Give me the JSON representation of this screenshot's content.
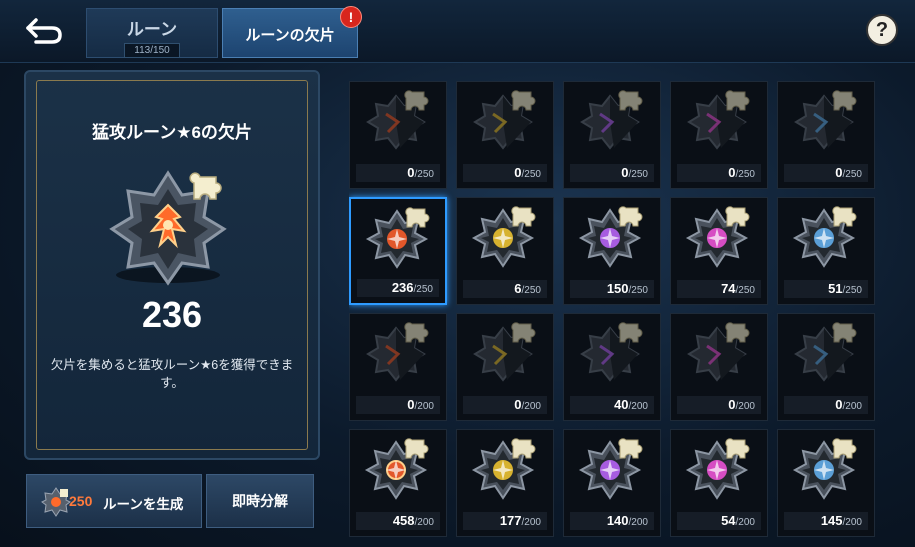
{
  "tabs": {
    "runes": {
      "label": "ルーン",
      "count": "113/150"
    },
    "shards": {
      "label": "ルーンの欠片",
      "alert": "!"
    }
  },
  "help_label": "?",
  "detail": {
    "title": "猛攻ルーン★6の欠片",
    "count": "236",
    "description": "欠片を集めると猛攻ルーン★6を獲得できます。"
  },
  "buttons": {
    "generate": {
      "cost": "250",
      "label": "ルーンを生成"
    },
    "dismantle": "即時分解"
  },
  "shards": [
    {
      "row": 0,
      "col": 0,
      "count": "0",
      "max": "/250",
      "color": "#e2572a",
      "kind": "broken"
    },
    {
      "row": 0,
      "col": 1,
      "count": "0",
      "max": "/250",
      "color": "#d7b22f",
      "kind": "broken"
    },
    {
      "row": 0,
      "col": 2,
      "count": "0",
      "max": "/250",
      "color": "#a75ce0",
      "kind": "broken"
    },
    {
      "row": 0,
      "col": 3,
      "count": "0",
      "max": "/250",
      "color": "#d64dc3",
      "kind": "broken"
    },
    {
      "row": 0,
      "col": 4,
      "count": "0",
      "max": "/250",
      "color": "#5b9fd6",
      "kind": "broken"
    },
    {
      "row": 1,
      "col": 0,
      "count": "236",
      "max": "/250",
      "color": "#e2572a",
      "kind": "full",
      "selected": true
    },
    {
      "row": 1,
      "col": 1,
      "count": "6",
      "max": "/250",
      "color": "#d7b22f",
      "kind": "full"
    },
    {
      "row": 1,
      "col": 2,
      "count": "150",
      "max": "/250",
      "color": "#a75ce0",
      "kind": "full"
    },
    {
      "row": 1,
      "col": 3,
      "count": "74",
      "max": "/250",
      "color": "#d64dc3",
      "kind": "full"
    },
    {
      "row": 1,
      "col": 4,
      "count": "51",
      "max": "/250",
      "color": "#5b9fd6",
      "kind": "full"
    },
    {
      "row": 2,
      "col": 0,
      "count": "0",
      "max": "/200",
      "color": "#e2572a",
      "kind": "broken"
    },
    {
      "row": 2,
      "col": 1,
      "count": "0",
      "max": "/200",
      "color": "#d7b22f",
      "kind": "broken"
    },
    {
      "row": 2,
      "col": 2,
      "count": "40",
      "max": "/200",
      "color": "#a75ce0",
      "kind": "broken"
    },
    {
      "row": 2,
      "col": 3,
      "count": "0",
      "max": "/200",
      "color": "#d64dc3",
      "kind": "broken"
    },
    {
      "row": 2,
      "col": 4,
      "count": "0",
      "max": "/200",
      "color": "#5b9fd6",
      "kind": "broken"
    },
    {
      "row": 3,
      "col": 0,
      "count": "458",
      "max": "/200",
      "color": "#e2572a",
      "kind": "full",
      "bright": true
    },
    {
      "row": 3,
      "col": 1,
      "count": "177",
      "max": "/200",
      "color": "#d7b22f",
      "kind": "full"
    },
    {
      "row": 3,
      "col": 2,
      "count": "140",
      "max": "/200",
      "color": "#a75ce0",
      "kind": "full"
    },
    {
      "row": 3,
      "col": 3,
      "count": "54",
      "max": "/200",
      "color": "#d64dc3",
      "kind": "full"
    },
    {
      "row": 3,
      "col": 4,
      "count": "145",
      "max": "/200",
      "color": "#5b9fd6",
      "kind": "full"
    }
  ]
}
